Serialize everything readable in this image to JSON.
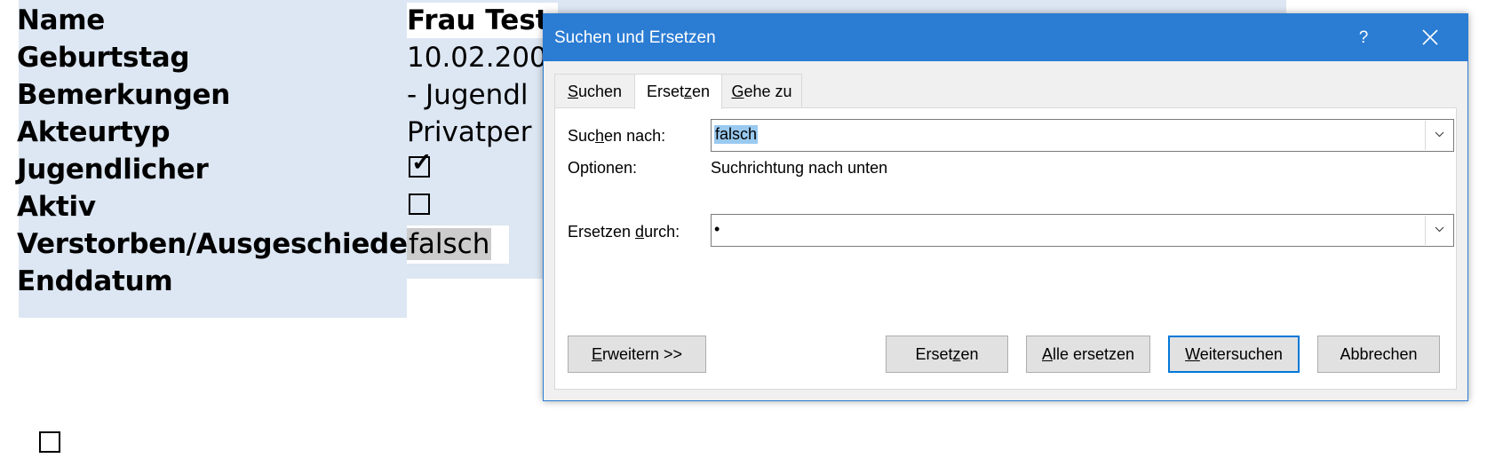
{
  "document": {
    "rows": [
      {
        "label": "Name",
        "value": "Frau Test"
      },
      {
        "label": "Geburtstag",
        "value": "10.02.200"
      },
      {
        "label": "Bemerkungen",
        "value": "- Jugendl"
      },
      {
        "label": "Akteurtyp",
        "value": "Privatper"
      },
      {
        "label": "Jugendlicher",
        "checked": true
      },
      {
        "label": "Aktiv",
        "checked": false
      },
      {
        "label": "Verstorben/Ausgeschieden",
        "value": "falsch"
      },
      {
        "label": "Enddatum",
        "value": ""
      }
    ],
    "bottom_checkbox_checked": false
  },
  "dialog": {
    "title": "Suchen und Ersetzen",
    "help": "?",
    "tabs": [
      {
        "label": "Suchen",
        "mnemonic": "S",
        "active": false
      },
      {
        "label": "Ersetzen",
        "mnemonic": "z",
        "active": true
      },
      {
        "label": "Gehe zu",
        "mnemonic": "G",
        "active": false
      }
    ],
    "find_label": "Suchen nach:",
    "find_value": "falsch",
    "options_label": "Optionen:",
    "options_value": "Suchrichtung nach unten",
    "replace_label": "Ersetzen durch:",
    "replace_value": "•",
    "buttons": {
      "expand": "Erweitern >>",
      "replace": "Ersetzen",
      "replace_all": "Alle ersetzen",
      "find_next": "Weitersuchen",
      "cancel": "Abbrechen"
    },
    "accent_color": "#2b7cd3"
  }
}
